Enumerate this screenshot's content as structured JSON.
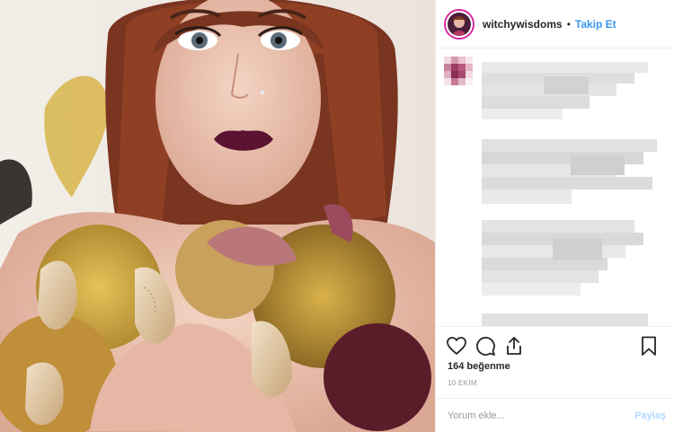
{
  "post": {
    "username": "witchywisdoms",
    "separator": "•",
    "follow_label": "Takip Et",
    "likes_text": "164 beğenme",
    "date_text": "10 EKİM",
    "comment_placeholder": "Yorum ekle...",
    "post_label": "Paylaş"
  },
  "icons": {
    "like": "heart-icon",
    "comment": "speech-bubble-icon",
    "share": "share-icon",
    "save": "bookmark-icon"
  },
  "colors": {
    "link_blue": "#3897f0",
    "post_disabled": "#b3d8ff",
    "avatar_ring": "#d6249f",
    "divider": "#efefef"
  }
}
